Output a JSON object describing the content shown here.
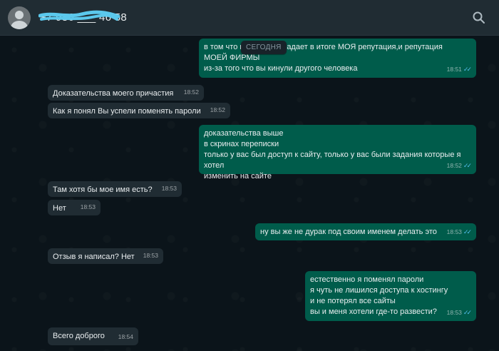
{
  "header": {
    "contact_name": "+7 986 ___ 46 58",
    "search_icon": "search-icon"
  },
  "day_chip": "СЕГОДНЯ",
  "colors": {
    "incoming": "#202c33",
    "outgoing": "#005c4b",
    "read_ticks": "#53bdeb"
  },
  "messages": [
    {
      "dir": "out",
      "text": "в том что к        аферы, страдает в итоге МОЯ репутация,и репутация\nМОЕЙ ФИРМЫ\nиз-за того что вы кинули другого человека",
      "time": "18:51"
    },
    {
      "dir": "in",
      "text": "Доказательства моего причастия",
      "time": "18:52"
    },
    {
      "dir": "in",
      "text": "Как я понял Вы успели поменять пароли",
      "time": "18:52"
    },
    {
      "dir": "out",
      "text": "доказательства выше\nв скринах переписки\nтолько у вас был доступ к сайту, только у вас были задания которые я хотел\nизменить на сайте",
      "time": "18:52"
    },
    {
      "dir": "in",
      "text": "Там хотя бы мое имя есть?",
      "time": "18:53"
    },
    {
      "dir": "in",
      "text": "Нет",
      "time": "18:53"
    },
    {
      "dir": "out",
      "text": "ну вы же не дурак под своим именем делать это",
      "time": "18:53"
    },
    {
      "dir": "in",
      "text": "Отзыв я написал? Нет",
      "time": "18:53"
    },
    {
      "dir": "out",
      "text": "естественно я поменял пароли\nя чуть не лишился доступа к хостингу\nи не потерял все сайты\nвы и меня хотели где-то развести?",
      "time": "18:53"
    },
    {
      "dir": "in",
      "text": "Всего доброго",
      "time": "18:54"
    }
  ]
}
